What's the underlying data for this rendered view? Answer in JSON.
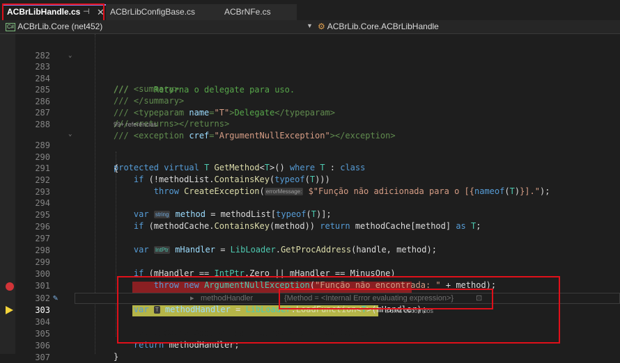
{
  "tabs": [
    {
      "label": "ACBrLibHandle.cs",
      "active": true,
      "pin": "⊣",
      "close": "✕"
    },
    {
      "label": "ACBrLibConfigBase.cs",
      "active": false
    },
    {
      "label": "ACBrNFe.cs",
      "active": false
    }
  ],
  "navbar": {
    "project_icon": "C#",
    "project": "ACBrLib.Core (net452)",
    "class_icon": "class-icon",
    "class": "ACBrLib.Core.ACBrLibHandle"
  },
  "code": {
    "ln282": "282",
    "ln283": "283",
    "ln284": "284",
    "ln285": "285",
    "ln286": "286",
    "ln287": "287",
    "ln288": "288",
    "ln289": "289",
    "ln290": "290",
    "ln291": "291",
    "ln292": "292",
    "ln293": "293",
    "ln294": "294",
    "ln295": "295",
    "ln296": "296",
    "ln297": "297",
    "ln298": "298",
    "ln299": "299",
    "ln300": "300",
    "ln301": "301",
    "ln302": "302",
    "ln303": "303",
    "ln304": "304",
    "ln305": "305",
    "ln306": "306",
    "ln307": "307",
    "references": "99+ referências",
    "hint_error_message": "errorMessage:",
    "hint_string": "string",
    "hint_intptr": "IntPtr",
    "hint_t": "T",
    "datatip_var": "methodHandler",
    "datatip_value": "{Method = <Internal Error evaluating expression>}",
    "elapsed": "≤ 5ms decorridos"
  },
  "colors": {
    "breakpoint": "#d13438",
    "current_statement": "#f4d43b",
    "annotation_box": "#e0101a",
    "active_tab_accent": "#9a7cf0"
  }
}
